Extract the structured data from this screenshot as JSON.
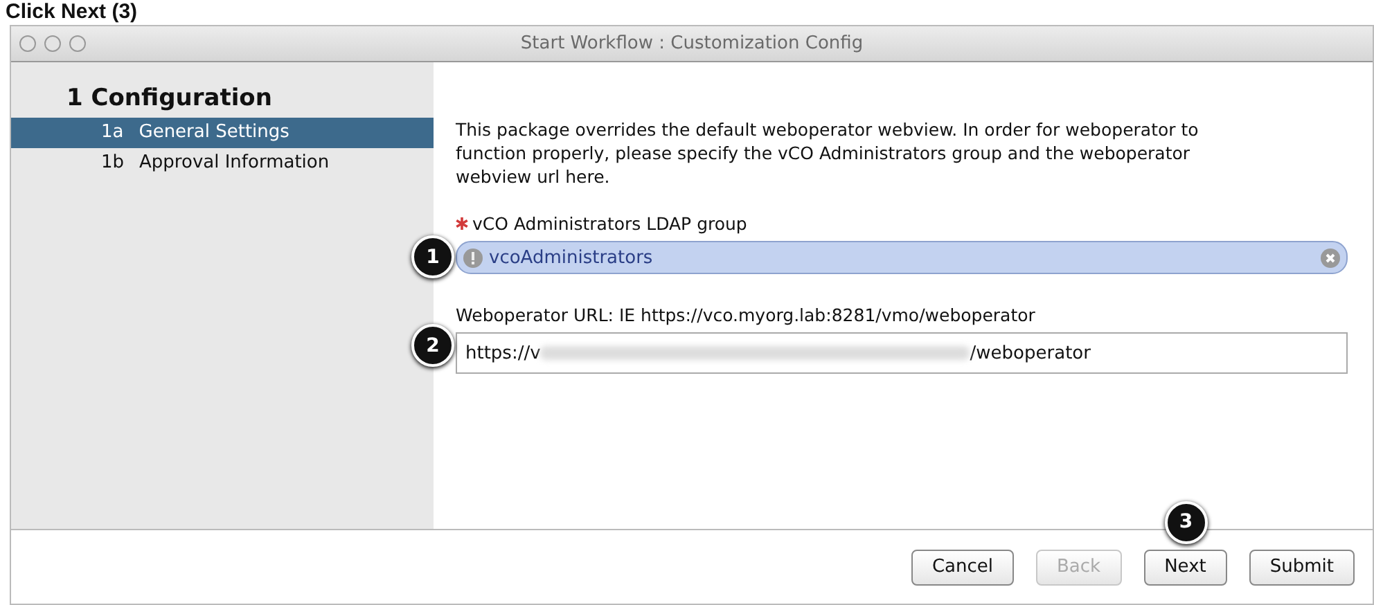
{
  "heading": "Click Next (3)",
  "window": {
    "title": "Start Workflow : Customization Config"
  },
  "sidebar": {
    "section": "1  Configuration",
    "items": [
      {
        "number": "1a",
        "label": "General Settings",
        "selected": true
      },
      {
        "number": "1b",
        "label": "Approval Information",
        "selected": false
      }
    ]
  },
  "description": "This package overrides the default weboperator webview. In order for weboperator to function properly, please specify the vCO Administrators group and the weboperator webview url here.",
  "fields": [
    {
      "kind": "token",
      "label": "vCO Administrators LDAP group",
      "required": true,
      "value": "vcoAdministrators",
      "callout": "1"
    },
    {
      "kind": "text",
      "label": "Weboperator URL: IE https://vco.myorg.lab:8281/vmo/weboperator",
      "required": false,
      "value": "https://v",
      "redacted": true,
      "suffix": "/weboperator",
      "callout": "2"
    }
  ],
  "buttons": [
    {
      "label": "Cancel",
      "disabled": false
    },
    {
      "label": "Back",
      "disabled": true
    },
    {
      "label": "Next",
      "disabled": false,
      "callout": "3"
    },
    {
      "label": "Submit",
      "disabled": false
    }
  ]
}
